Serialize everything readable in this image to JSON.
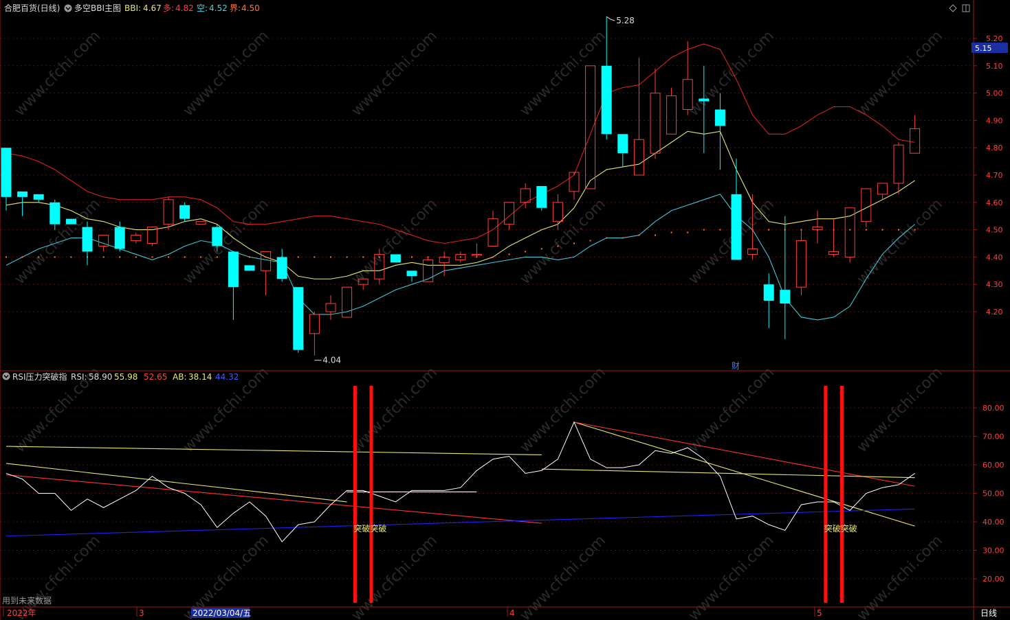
{
  "top_header": {
    "stock": "合肥百货(日线)",
    "indicator": "多空BBI主图",
    "bbi_label": "BBI:",
    "bbi_value": "4.67",
    "duo_label": "多:",
    "duo_value": "4.82",
    "kong_label": "空:",
    "kong_value": "4.52",
    "jie_label": "界:",
    "jie_value": "4.50"
  },
  "rsi_header": {
    "indicator": "RSI压力突破指",
    "rsi_label": "RSI:",
    "rsi_value": "58.90",
    "v2": "55.98",
    "v3": "52.65",
    "ab_label": "AB:",
    "ab_value": "38.14",
    "v5": "44.32"
  },
  "price_annotations": {
    "high": "5.28",
    "low": "4.04",
    "cai": "财"
  },
  "price_tag": "5.15",
  "breakout_label": "突破突破",
  "footer": {
    "note": "用到未来数据",
    "year": "2022年",
    "m3": "3",
    "date_cursor": "2022/03/04/五",
    "m4": "4",
    "m5": "5",
    "period": "日线"
  },
  "watermark": "www.cfchi.com",
  "colors": {
    "up": "#ff4040",
    "down": "#00ffff",
    "upper_band": "#e02020",
    "lower_band": "#40c8d8",
    "bbi": "#e8e870",
    "rsi": "#ffffff",
    "breakout": "#ff1010",
    "axis": "#a01818"
  },
  "chart_data": [
    {
      "type": "candlestick",
      "ylim": [
        4.1,
        5.25
      ],
      "yticks": [
        "5.20",
        "5.10",
        "5.00",
        "4.90",
        "4.80",
        "4.70",
        "4.60",
        "4.50",
        "4.40",
        "4.30",
        "4.20"
      ],
      "candles": [
        {
          "o": 4.8,
          "h": 4.8,
          "l": 4.57,
          "c": 4.62
        },
        {
          "o": 4.64,
          "h": 4.64,
          "l": 4.55,
          "c": 4.62
        },
        {
          "o": 4.63,
          "h": 4.63,
          "l": 4.6,
          "c": 4.61
        },
        {
          "o": 4.6,
          "h": 4.61,
          "l": 4.5,
          "c": 4.52
        },
        {
          "o": 4.54,
          "h": 4.54,
          "l": 4.52,
          "c": 4.52
        },
        {
          "o": 4.51,
          "h": 4.53,
          "l": 4.37,
          "c": 4.42
        },
        {
          "o": 4.44,
          "h": 4.48,
          "l": 4.42,
          "c": 4.48
        },
        {
          "o": 4.51,
          "h": 4.53,
          "l": 4.42,
          "c": 4.43
        },
        {
          "o": 4.46,
          "h": 4.49,
          "l": 4.45,
          "c": 4.48
        },
        {
          "o": 4.45,
          "h": 4.51,
          "l": 4.44,
          "c": 4.51
        },
        {
          "o": 4.52,
          "h": 4.62,
          "l": 4.5,
          "c": 4.61
        },
        {
          "o": 4.59,
          "h": 4.6,
          "l": 4.53,
          "c": 4.54
        },
        {
          "o": 4.52,
          "h": 4.53,
          "l": 4.52,
          "c": 4.53
        },
        {
          "o": 4.51,
          "h": 4.52,
          "l": 4.42,
          "c": 4.44
        },
        {
          "o": 4.42,
          "h": 4.42,
          "l": 4.17,
          "c": 4.29
        },
        {
          "o": 4.37,
          "h": 4.37,
          "l": 4.35,
          "c": 4.35
        },
        {
          "o": 4.35,
          "h": 4.42,
          "l": 4.26,
          "c": 4.42
        },
        {
          "o": 4.4,
          "h": 4.43,
          "l": 4.31,
          "c": 4.32
        },
        {
          "o": 4.29,
          "h": 4.29,
          "l": 4.05,
          "c": 4.06
        },
        {
          "o": 4.12,
          "h": 4.2,
          "l": 4.04,
          "c": 4.19
        },
        {
          "o": 4.2,
          "h": 4.26,
          "l": 4.17,
          "c": 4.23
        },
        {
          "o": 4.18,
          "h": 4.29,
          "l": 4.18,
          "c": 4.29
        },
        {
          "o": 4.3,
          "h": 4.32,
          "l": 4.28,
          "c": 4.32
        },
        {
          "o": 4.32,
          "h": 4.43,
          "l": 4.3,
          "c": 4.41
        },
        {
          "o": 4.41,
          "h": 4.41,
          "l": 4.38,
          "c": 4.38
        },
        {
          "o": 4.35,
          "h": 4.35,
          "l": 4.31,
          "c": 4.33
        },
        {
          "o": 4.31,
          "h": 4.4,
          "l": 4.31,
          "c": 4.39
        },
        {
          "o": 4.38,
          "h": 4.42,
          "l": 4.33,
          "c": 4.4
        },
        {
          "o": 4.39,
          "h": 4.42,
          "l": 4.38,
          "c": 4.41
        },
        {
          "o": 4.41,
          "h": 4.45,
          "l": 4.4,
          "c": 4.41
        },
        {
          "o": 4.44,
          "h": 4.57,
          "l": 4.44,
          "c": 4.54
        },
        {
          "o": 4.52,
          "h": 4.6,
          "l": 4.5,
          "c": 4.6
        },
        {
          "o": 4.6,
          "h": 4.67,
          "l": 4.58,
          "c": 4.65
        },
        {
          "o": 4.66,
          "h": 4.66,
          "l": 4.57,
          "c": 4.58
        },
        {
          "o": 4.53,
          "h": 4.63,
          "l": 4.5,
          "c": 4.6
        },
        {
          "o": 4.64,
          "h": 4.7,
          "l": 4.61,
          "c": 4.71
        },
        {
          "o": 4.65,
          "h": 5.1,
          "l": 4.65,
          "c": 5.1
        },
        {
          "o": 5.1,
          "h": 5.28,
          "l": 4.83,
          "c": 4.85
        },
        {
          "o": 4.85,
          "h": 4.85,
          "l": 4.73,
          "c": 4.78
        },
        {
          "o": 4.7,
          "h": 5.13,
          "l": 4.7,
          "c": 4.83
        },
        {
          "o": 4.78,
          "h": 5.09,
          "l": 4.76,
          "c": 5.0
        },
        {
          "o": 4.85,
          "h": 5.02,
          "l": 4.85,
          "c": 4.99
        },
        {
          "o": 4.94,
          "h": 5.19,
          "l": 4.92,
          "c": 5.05
        },
        {
          "o": 4.98,
          "h": 5.1,
          "l": 4.78,
          "c": 4.97
        },
        {
          "o": 4.94,
          "h": 5.0,
          "l": 4.72,
          "c": 4.88
        },
        {
          "o": 4.63,
          "h": 4.76,
          "l": 4.39,
          "c": 4.39
        },
        {
          "o": 4.41,
          "h": 4.63,
          "l": 4.39,
          "c": 4.43
        },
        {
          "o": 4.3,
          "h": 4.34,
          "l": 4.14,
          "c": 4.24
        },
        {
          "o": 4.28,
          "h": 4.55,
          "l": 4.1,
          "c": 4.23
        },
        {
          "o": 4.29,
          "h": 4.5,
          "l": 4.26,
          "c": 4.46
        },
        {
          "o": 4.5,
          "h": 4.57,
          "l": 4.45,
          "c": 4.51
        },
        {
          "o": 4.41,
          "h": 4.54,
          "l": 4.4,
          "c": 4.42
        },
        {
          "o": 4.4,
          "h": 4.58,
          "l": 4.38,
          "c": 4.58
        },
        {
          "o": 4.53,
          "h": 4.65,
          "l": 4.51,
          "c": 4.65
        },
        {
          "o": 4.63,
          "h": 4.67,
          "l": 4.61,
          "c": 4.67
        },
        {
          "o": 4.67,
          "h": 4.82,
          "l": 4.63,
          "c": 4.81
        },
        {
          "o": 4.78,
          "h": 4.92,
          "l": 4.78,
          "c": 4.87
        }
      ],
      "upper_band": [
        4.78,
        4.77,
        4.75,
        4.72,
        4.68,
        4.64,
        4.62,
        4.61,
        4.61,
        4.61,
        4.62,
        4.62,
        4.61,
        4.58,
        4.53,
        4.52,
        4.52,
        4.53,
        4.54,
        4.55,
        4.55,
        4.54,
        4.53,
        4.52,
        4.5,
        4.48,
        4.46,
        4.45,
        4.46,
        4.47,
        4.5,
        4.55,
        4.6,
        4.63,
        4.66,
        4.7,
        4.85,
        5.0,
        5.02,
        5.03,
        5.08,
        5.13,
        5.16,
        5.18,
        5.16,
        5.05,
        4.92,
        4.85,
        4.85,
        4.88,
        4.92,
        4.95,
        4.95,
        4.92,
        4.88,
        4.83,
        4.82
      ],
      "lower_band": [
        4.37,
        4.4,
        4.43,
        4.45,
        4.47,
        4.47,
        4.45,
        4.43,
        4.41,
        4.39,
        4.41,
        4.44,
        4.46,
        4.45,
        4.42,
        4.4,
        4.39,
        4.38,
        4.25,
        4.19,
        4.19,
        4.2,
        4.22,
        4.25,
        4.28,
        4.3,
        4.32,
        4.35,
        4.36,
        4.37,
        4.38,
        4.39,
        4.4,
        4.4,
        4.39,
        4.4,
        4.44,
        4.47,
        4.47,
        4.48,
        4.53,
        4.57,
        4.59,
        4.61,
        4.63,
        4.55,
        4.5,
        4.4,
        4.25,
        4.18,
        4.17,
        4.18,
        4.22,
        4.32,
        4.41,
        4.47,
        4.52
      ],
      "bbi": [
        4.59,
        4.6,
        4.6,
        4.59,
        4.57,
        4.54,
        4.53,
        4.51,
        4.5,
        4.5,
        4.51,
        4.53,
        4.54,
        4.52,
        4.47,
        4.43,
        4.4,
        4.38,
        4.33,
        4.32,
        4.32,
        4.33,
        4.35,
        4.35,
        4.37,
        4.38,
        4.37,
        4.37,
        4.37,
        4.38,
        4.4,
        4.44,
        4.47,
        4.5,
        4.52,
        4.58,
        4.68,
        4.72,
        4.73,
        4.74,
        4.78,
        4.82,
        4.86,
        4.85,
        4.86,
        4.72,
        4.6,
        4.53,
        4.52,
        4.53,
        4.54,
        4.54,
        4.55,
        4.58,
        4.61,
        4.64,
        4.68
      ],
      "jie_dots": [
        4.4,
        4.4,
        4.4,
        4.4,
        4.4,
        4.4,
        4.4,
        4.4,
        4.4,
        4.4,
        4.4,
        4.4,
        4.4,
        4.4,
        4.4,
        4.4,
        4.4,
        4.4,
        4.4,
        4.4,
        4.4,
        4.4,
        4.4,
        4.4,
        4.4,
        4.4,
        4.4,
        4.4,
        4.4,
        4.4,
        4.4,
        4.41,
        4.42,
        4.43,
        4.44,
        4.45,
        4.46,
        4.47,
        4.47,
        4.48,
        4.48,
        4.49,
        4.49,
        4.5,
        4.5,
        4.5,
        4.5,
        4.5,
        4.5,
        4.5,
        4.5,
        4.5,
        4.5,
        4.5,
        4.5,
        4.5,
        4.5
      ]
    },
    {
      "type": "line",
      "ylim": [
        15,
        88
      ],
      "yticks": [
        "80.00",
        "70.00",
        "60.00",
        "50.00",
        "40.00",
        "30.00",
        "20.00"
      ],
      "series": [
        {
          "name": "RSI",
          "values": [
            57,
            55,
            50,
            50,
            44,
            48,
            45,
            48,
            51,
            56,
            52,
            50,
            46,
            38,
            43,
            47,
            42,
            33,
            39,
            40,
            46,
            51,
            51,
            49,
            47,
            51,
            51,
            51,
            52,
            58,
            62,
            63,
            57,
            58,
            62,
            75,
            62,
            59,
            59,
            60,
            65,
            64,
            66,
            62,
            56,
            41,
            42,
            39,
            37,
            46,
            47,
            47,
            44,
            50,
            52,
            53,
            57
          ]
        }
      ],
      "trend_lines": [
        {
          "from": [
            0,
            66.5
          ],
          "to": [
            33,
            63.5
          ],
          "color": "#e8e870"
        },
        {
          "from": [
            0,
            60.5
          ],
          "to": [
            21,
            47.0
          ],
          "color": "#e8e870"
        },
        {
          "from": [
            0,
            56.5
          ],
          "to": [
            33,
            39.5
          ],
          "color": "#ff3030"
        },
        {
          "from": [
            21,
            50.5
          ],
          "to": [
            29,
            50.5
          ],
          "color": "#ffffff"
        },
        {
          "from": [
            35,
            75.0
          ],
          "to": [
            56,
            38.5
          ],
          "color": "#e8e870"
        },
        {
          "from": [
            35,
            75.0
          ],
          "to": [
            56,
            52.5
          ],
          "color": "#ff3030"
        },
        {
          "from": [
            33,
            58.5
          ],
          "to": [
            56,
            55.5
          ],
          "color": "#e8e870"
        },
        {
          "from": [
            0,
            35.0
          ],
          "to": [
            56,
            44.5
          ],
          "color": "#2020ff"
        }
      ],
      "breakouts": [
        21.5,
        22.5,
        50.5,
        51.5
      ]
    }
  ]
}
